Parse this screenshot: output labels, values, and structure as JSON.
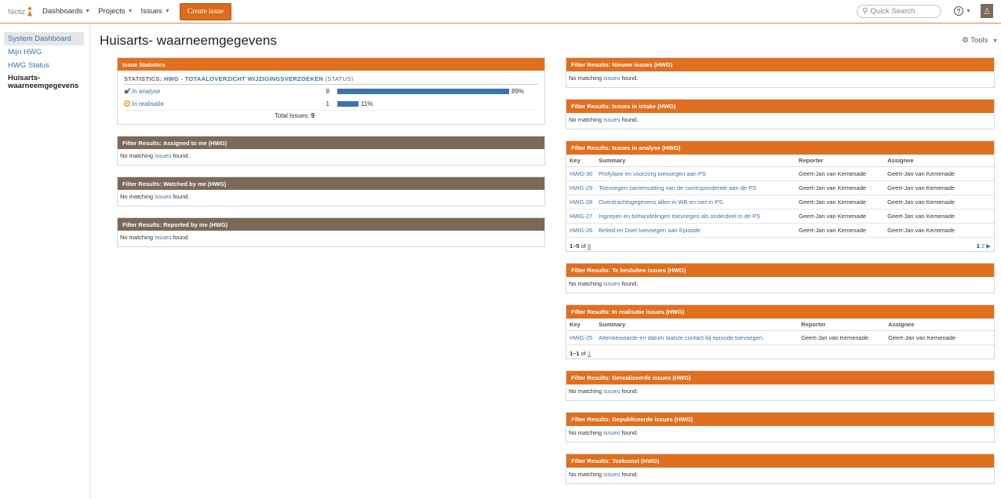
{
  "header": {
    "logo_text": "Nictiz",
    "nav": [
      {
        "label": "Dashboards"
      },
      {
        "label": "Projects"
      },
      {
        "label": "Issues"
      }
    ],
    "create_label": "Create issue",
    "search_placeholder": "Quick Search"
  },
  "sidebar": {
    "items": [
      {
        "label": "System Dashboard"
      },
      {
        "label": "Mijn HWG"
      },
      {
        "label": "HWG Status"
      },
      {
        "label": "Huisarts- waarneemgegevens"
      }
    ]
  },
  "page": {
    "title": "Huisarts- waarneemgegevens",
    "tools_label": "Tools"
  },
  "common": {
    "no_match_prefix": "No matching",
    "no_match_link": "issues",
    "no_match_suffix": "found."
  },
  "stats": {
    "header": "Issue Statistics",
    "title_prefix": "STATISTICS:",
    "title_link": "HWG - TOTAALOVERZICHT WIJZIGINGSVERZOEKEN",
    "title_suffix": "(STATUS)",
    "rows": [
      {
        "label": "In analyse",
        "count": "8",
        "percent": "89%",
        "fraction": 0.89
      },
      {
        "label": "In realisatie",
        "count": "1",
        "percent": "11%",
        "fraction": 0.11
      }
    ],
    "total_label": "Total Issues:",
    "total_value": "9"
  },
  "left_gadgets": [
    {
      "title": "Filter Results: Assigned to me (HWG)"
    },
    {
      "title": "Filter Results: Watched by me (HWG)"
    },
    {
      "title": "Filter Results: Reported by me (HWG)"
    }
  ],
  "right": {
    "nieuwe": {
      "title": "Filter Results: Nieuwe issues (HWG)"
    },
    "intake": {
      "title": "Filter Results: Issues in intake (HWG)"
    },
    "analyse": {
      "title": "Filter Results: Issues in analyse (HWG)",
      "columns": [
        "Key",
        "Summary",
        "Reporter",
        "Assignee"
      ],
      "rows": [
        {
          "key": "HWG-30",
          "summary": "Profylaxe en voorzorg toevoegen aan PS",
          "reporter": "Geert-Jan van Kemenade",
          "assignee": "Geert-Jan van Kemenade"
        },
        {
          "key": "HWG-29",
          "summary": "Toevoegen samenvatting van de correspondentie aan de PS",
          "reporter": "Geert-Jan van Kemenade",
          "assignee": "Geert-Jan van Kemenade"
        },
        {
          "key": "HWG-28",
          "summary": "Overdrachtsgegevens allen in WB en niet in PS.",
          "reporter": "Geert-Jan van Kemenade",
          "assignee": "Geert-Jan van Kemenade"
        },
        {
          "key": "HWG-27",
          "summary": "Ingrepen en behandelingen toevoegen als onderdeel in de PS",
          "reporter": "Geert-Jan van Kemenade",
          "assignee": "Geert-Jan van Kemenade"
        },
        {
          "key": "HWG-26",
          "summary": "Beleid en Doel toevoegen aan Episode",
          "reporter": "Geert-Jan van Kemenade",
          "assignee": "Geert-Jan van Kemenade"
        }
      ],
      "range": "1–5",
      "of": "of",
      "total": "8",
      "pages": [
        "1",
        "2"
      ]
    },
    "besluiten": {
      "title": "Filter Results: Te besluiten issues (HWG)"
    },
    "realisatie": {
      "title": "Filter Results: In realisatie issues (HWG)",
      "columns": [
        "Key",
        "Summary",
        "Reporter",
        "Assignee"
      ],
      "rows": [
        {
          "key": "HWG-25",
          "summary": "Attentiewaarde en datum laatste contact bij episode toevoegen.",
          "reporter": "Geert-Jan van Kemenade",
          "assignee": "Geert-Jan van Kemenade"
        }
      ],
      "range": "1–1",
      "of": "of",
      "total": "1"
    },
    "gerealiseerde": {
      "title": "Filter Results: Gerealiseerde issues (HWG)"
    },
    "gepubliceerde": {
      "title": "Filter Results: Gepubliceerde issues (HWG)"
    },
    "toekomst": {
      "title": "Filter Results: Toekomst (HWG)"
    }
  },
  "colors": {
    "orange_header": "#e07020",
    "brown_header": "#7b6a5a",
    "link": "#3b73af",
    "bar": "#3b73af"
  }
}
